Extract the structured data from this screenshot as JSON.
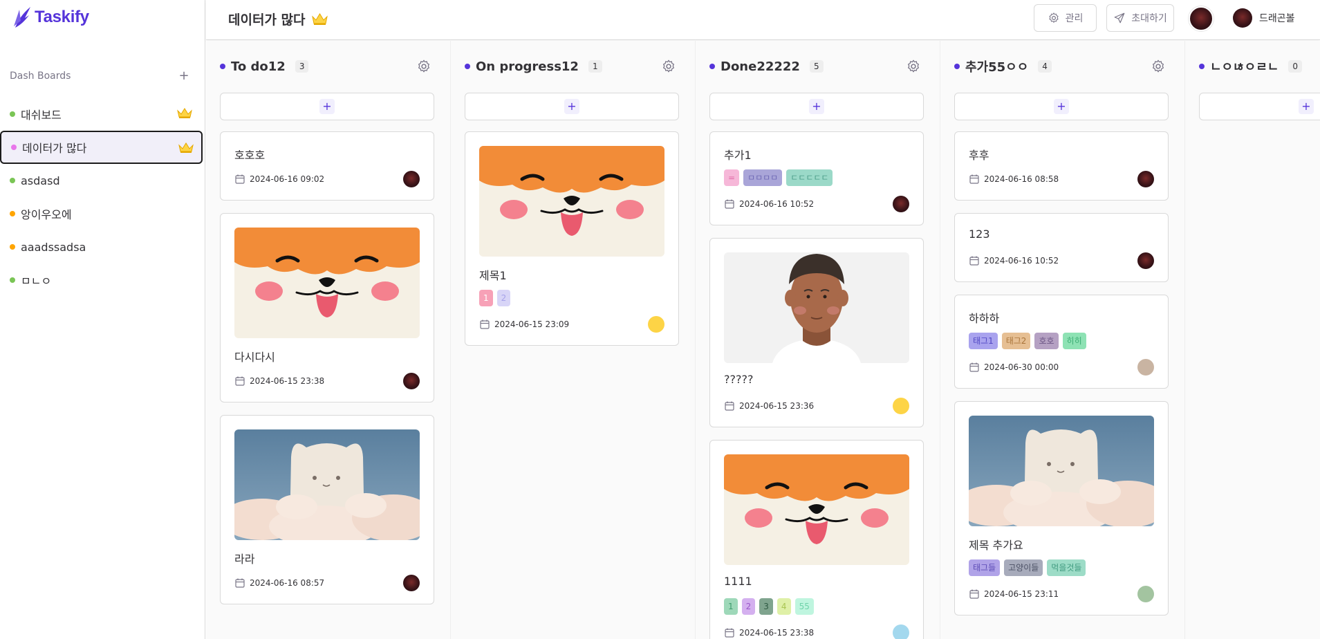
{
  "app": {
    "name": "Taskify"
  },
  "sidebar": {
    "section_label": "Dash Boards",
    "add_label": "+",
    "boards": [
      {
        "label": "대쉬보드",
        "color": "#7ac555",
        "owner": true,
        "active": false
      },
      {
        "label": "데이터가 많다",
        "color": "#e876ea",
        "owner": true,
        "active": true
      },
      {
        "label": "asdasd",
        "color": "#7ac555",
        "owner": false,
        "active": false
      },
      {
        "label": "앙이우오에",
        "color": "#ffa500",
        "owner": false,
        "active": false
      },
      {
        "label": "aaadssadsa",
        "color": "#ffa500",
        "owner": false,
        "active": false
      },
      {
        "label": "ㅁㄴㅇ",
        "color": "#7ac555",
        "owner": false,
        "active": false
      }
    ]
  },
  "header": {
    "title": "데이터가 많다",
    "manage_label": "관리",
    "invite_label": "초대하기",
    "user_name": "드래곤볼"
  },
  "columns": [
    {
      "title": "To do12",
      "count": "3",
      "cards": [
        {
          "title": "호호호",
          "date": "2024-06-16 09:02",
          "image": null,
          "tags": [],
          "avatar": "dark"
        },
        {
          "title": "다시다시",
          "date": "2024-06-15 23:38",
          "image": "shiba",
          "tags": [],
          "avatar": "dark"
        },
        {
          "title": "라라",
          "date": "2024-06-16 08:57",
          "image": "cat",
          "tags": [],
          "avatar": "dark"
        }
      ]
    },
    {
      "title": "On progress12",
      "count": "1",
      "cards": [
        {
          "title": "제목1",
          "date": "2024-06-15 23:09",
          "image": "shiba",
          "tags": [
            {
              "label": "1",
              "bg": "#f7a1b7",
              "fg": "#ffffff"
            },
            {
              "label": "2",
              "bg": "#d8d5f7",
              "fg": "#a6a2ea"
            }
          ],
          "avatar": "#fdd446"
        }
      ]
    },
    {
      "title": "Done22222",
      "count": "5",
      "cards": [
        {
          "title": "추가1",
          "date": "2024-06-16 10:52",
          "image": null,
          "tags": [
            {
              "label": "=",
              "bg": "#f6b7d8",
              "fg": "#e067a5"
            },
            {
              "label": "ㅁㅁㅁㅁ",
              "bg": "#a9a5d8",
              "fg": "#6d68b5"
            },
            {
              "label": "ㄷㄷㄷㄷㄷ",
              "bg": "#9bd9c8",
              "fg": "#4a9c87"
            }
          ],
          "avatar": "dark"
        },
        {
          "title": "?????",
          "date": "2024-06-15 23:36",
          "image": "person",
          "tags": [],
          "avatar": "#fdd446"
        },
        {
          "title": "1111",
          "date": "2024-06-15 23:38",
          "image": "shiba",
          "tags": [
            {
              "label": "1",
              "bg": "#9ed8b9",
              "fg": "#3f9b6d"
            },
            {
              "label": "2",
              "bg": "#d4b0ef",
              "fg": "#9a56c9"
            },
            {
              "label": "3",
              "bg": "#7fa48e",
              "fg": "#2f5a43"
            },
            {
              "label": "4",
              "bg": "#dff0a7",
              "fg": "#a9c552"
            },
            {
              "label": "55",
              "bg": "#bff5df",
              "fg": "#6fd3aa"
            }
          ],
          "avatar": "#a3d8ee"
        }
      ]
    },
    {
      "title": "추가55ㅇㅇ",
      "count": "4",
      "cards": [
        {
          "title": "후후",
          "date": "2024-06-16 08:58",
          "image": null,
          "tags": [],
          "avatar": "dark"
        },
        {
          "title": "123",
          "date": "2024-06-16 10:52",
          "image": null,
          "tags": [],
          "avatar": "dark"
        },
        {
          "title": "하하하",
          "date": "2024-06-30 00:00",
          "image": null,
          "tags": [
            {
              "label": "태그1",
              "bg": "#a9a3ee",
              "fg": "#4f46c3"
            },
            {
              "label": "태그2",
              "bg": "#e6bf93",
              "fg": "#a9743a"
            },
            {
              "label": "호호",
              "bg": "#b5a1c3",
              "fg": "#6c5584"
            },
            {
              "label": "히히",
              "bg": "#8ee2b4",
              "fg": "#3dae75"
            }
          ],
          "avatar": "#c9b4a2"
        },
        {
          "title": "제목 추가요",
          "date": "2024-06-15 23:11",
          "image": "cat",
          "tags": [
            {
              "label": "태그들",
              "bg": "#b0a3e8",
              "fg": "#5b4bb5"
            },
            {
              "label": "고양이들",
              "bg": "#a7abbb",
              "fg": "#4b5064"
            },
            {
              "label": "먹을것들",
              "bg": "#9ddcc7",
              "fg": "#3f9a7f"
            }
          ],
          "avatar": "#a3c4a0"
        }
      ]
    },
    {
      "title": "ㄴㅇㄶㅇㄹㄴ",
      "count": "0",
      "cards": []
    }
  ]
}
